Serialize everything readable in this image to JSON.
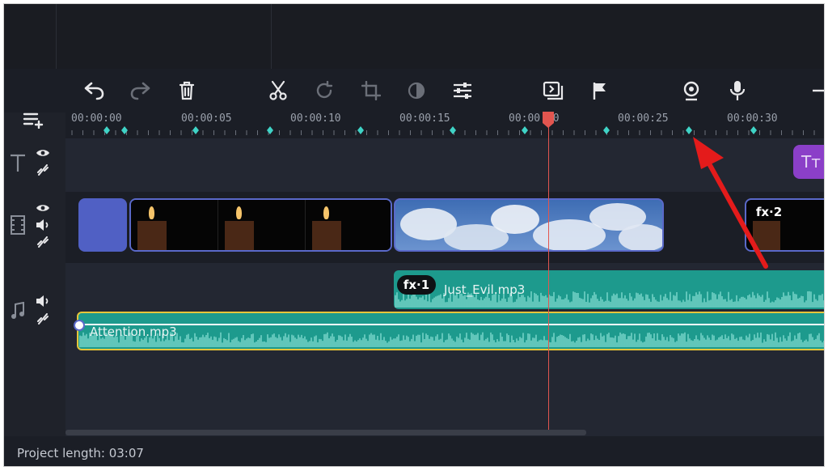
{
  "timeline": {
    "ruler_ticks": [
      "00:00:00",
      "00:00:05",
      "00:00:10",
      "00:00:15",
      "00:00:20",
      "00:00:25",
      "00:00:30"
    ],
    "playhead_time": "00:00:20"
  },
  "toolbar": {
    "icons": [
      "undo-icon",
      "redo-icon",
      "delete-icon",
      "cut-icon",
      "rotate-icon",
      "crop-icon",
      "color-adjust-icon",
      "properties-icon",
      "clip-properties-icon",
      "marker-flag-icon",
      "webcam-icon",
      "microphone-icon",
      "zoom-out-icon"
    ]
  },
  "tracks": {
    "title_track_icon": "title-track-icon",
    "title_clip_label": "Tт",
    "video_clip_fx_badge": "fx·2",
    "audio_clips": [
      {
        "name": "Just_Evil.mp3",
        "fx_badge": "fx·1"
      },
      {
        "name": "Attention.mp3"
      }
    ]
  },
  "status": {
    "project_length": "Project length: 03:07"
  },
  "colors": {
    "background": "#1b1e26",
    "clip_border": "#5a69c9",
    "audio_teal": "#1d9a8d",
    "waveform": "#8ee3d9",
    "playhead": "#e2554f",
    "selection_yellow": "#e6c53a",
    "marker_cyan": "#3fd3c6",
    "annotation_arrow": "#e41b1b"
  }
}
